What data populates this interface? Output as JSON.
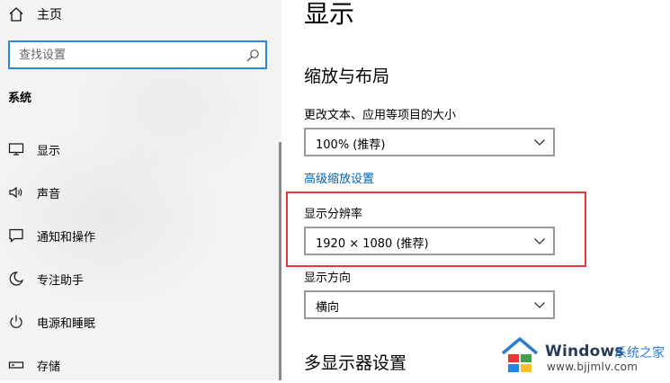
{
  "sidebar": {
    "home_label": "主页",
    "search_placeholder": "查找设置",
    "section_title": "系统",
    "items": [
      {
        "label": "显示",
        "icon": "monitor-icon"
      },
      {
        "label": "声音",
        "icon": "speaker-icon"
      },
      {
        "label": "通知和操作",
        "icon": "notification-icon"
      },
      {
        "label": "专注助手",
        "icon": "moon-icon"
      },
      {
        "label": "电源和睡眠",
        "icon": "power-icon"
      },
      {
        "label": "存储",
        "icon": "storage-icon"
      }
    ]
  },
  "main": {
    "title": "显示",
    "scale_layout": {
      "heading": "缩放与布局",
      "text_size_label": "更改文本、应用等项目的大小",
      "text_size_value": "100% (推荐)",
      "advanced_link": "高级缩放设置",
      "resolution_label": "显示分辨率",
      "resolution_value": "1920 × 1080 (推荐)",
      "orientation_label": "显示方向",
      "orientation_value": "横向"
    },
    "multi_display_heading": "多显示器设置"
  },
  "watermark": {
    "brand": "Windows",
    "brand_suffix": "系统之家",
    "url": "www.bjjmlv.com"
  },
  "colors": {
    "accent": "#0063b1",
    "search_border": "#2b88d8",
    "highlight": "#e03b3b"
  }
}
